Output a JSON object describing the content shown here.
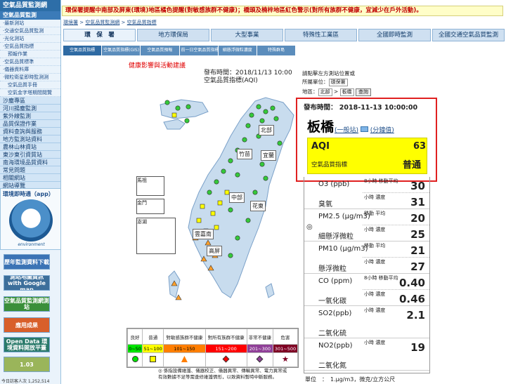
{
  "nav": {
    "header": "空氣品質監測網",
    "items": [
      {
        "label": "空氣品質監測",
        "type": "head"
      },
      {
        "label": "‧最新測站",
        "type": "sub"
      },
      {
        "label": "‧交通空氣品質監測",
        "type": "sub"
      },
      {
        "label": "‧光化測站",
        "type": "sub"
      },
      {
        "label": "‧空氣品質指標",
        "type": "sub"
      },
      {
        "label": "　預報作業",
        "type": "sub"
      },
      {
        "label": "‧空氣品質標準",
        "type": "sub"
      },
      {
        "label": "‧儀器資料庫",
        "type": "sub"
      },
      {
        "label": "‧微粒衛星即時監測測",
        "type": "sub"
      },
      {
        "label": "　空氣品質手冊",
        "type": "sub"
      },
      {
        "label": "　空氣金字塔期間閱覽",
        "type": "sub"
      },
      {
        "label": "沙塵專區",
        "type": "item"
      },
      {
        "label": "河川揚塵監測",
        "type": "item"
      },
      {
        "label": "紫外線監測",
        "type": "item"
      },
      {
        "label": "品質保證作業",
        "type": "item"
      },
      {
        "label": "資料查詢與服務",
        "type": "item"
      },
      {
        "label": "地方監測站資料",
        "type": "item"
      },
      {
        "label": "農林山林資站",
        "type": "item"
      },
      {
        "label": "東沙東引資質站",
        "type": "item"
      },
      {
        "label": "南海環境品質資料",
        "type": "item"
      },
      {
        "label": "常見問題",
        "type": "item"
      },
      {
        "label": "相關網站",
        "type": "item"
      },
      {
        "label": "網站導覽",
        "type": "item"
      }
    ],
    "app_title": "環境即時通（app）",
    "app_caption": "environment",
    "banners": [
      {
        "label": "歷年監測資料下載",
        "color": "#3b73b5"
      },
      {
        "label": "測站地圖資訊 with Google map",
        "color": "#3d6f9b"
      },
      {
        "label": "空氣品質監測網測站",
        "color": "#3a8f3a"
      },
      {
        "label": "應用成果",
        "color": "#d85f2a"
      },
      {
        "label": "Open Data 環境資料開放平臺",
        "color": "#2a7a6a"
      },
      {
        "label": "1.03",
        "color": "#9ab55a"
      }
    ],
    "visitor": "今日訪客人次 1,252,514"
  },
  "alert": "環保署提醒中南部及屏東(環境)地區橘色提醒(對敏感族群不健康)；橋頭及楠梓地區紅色警示(對所有族群不健康，宜減少在戶外活動)。",
  "breadcrumb": [
    "環境署",
    "空氣品質監測網",
    "空氣品質指標"
  ],
  "tabs": [
    "環　保　署",
    "地方環保局",
    "大型事業",
    "特殊性工業區",
    "全國即時監測",
    "全國交通空氣品質監測"
  ],
  "subtabs": [
    "空氣品質指標",
    "空氣品質指標(GIS)",
    "空氣品質預報",
    "前一日空氣品質指標",
    "細懸浮微粒濃度",
    "特殊群島"
  ],
  "map": {
    "health_link": "健康影響與活動建議",
    "time_label": "發布時間：2018/11/13 10:00",
    "aqi_label": "空氣品質指標(AQI)",
    "regions": [
      "北部",
      "竹苗",
      "宜蘭",
      "中部",
      "花東",
      "雲嘉南",
      "高屏",
      "馬祖",
      "金門",
      "澎湖"
    ]
  },
  "controls": {
    "hint": "請點擊左方測站位置或",
    "unit_label": "所屬單位：",
    "unit_value": "環保署",
    "area_label": "地區：",
    "area_value": "北部",
    "station_value": "板橋",
    "query_button": "查詢"
  },
  "station": {
    "publish": "發布時間： 2018-11-13 10:00:00",
    "name": "板橋",
    "link_general": "(一般站)",
    "link_minute": "(分鐘值)",
    "aqi_label": "AQI",
    "aqi_value": "63",
    "aqi_sub": "空氣品質指標",
    "aqi_status": "普通",
    "aqi_color": "#ffff00"
  },
  "pollutants": [
    {
      "name": "O3 (ppb)",
      "cname": "臭氧",
      "l1": "8小時 移動平均",
      "v1": "30",
      "l2": "小時 濃度",
      "v2": "31"
    },
    {
      "name": "PM2.5 (μg/m3)",
      "cname": "細懸浮微粒",
      "l1": "移動 平均",
      "v1": "20",
      "l2": "小時 濃度",
      "v2": "25"
    },
    {
      "name": "PM10 (μg/m3)",
      "cname": "懸浮微粒",
      "l1": "移動 平均",
      "v1": "21",
      "l2": "小時 濃度",
      "v2": "27"
    },
    {
      "name": "CO (ppm)",
      "cname": "一氧化碳",
      "l1": "8小時 移動平均",
      "v1": "0.40",
      "l2": "小時 濃度",
      "v2": "0.46"
    },
    {
      "name": "SO2(ppb)",
      "cname": "二氧化硫",
      "l1": "小時 濃度",
      "v1": "2.1",
      "l2": "",
      "v2": ""
    },
    {
      "name": "NO2(ppb)",
      "cname": "二氧化氮",
      "l1": "小時 濃度",
      "v1": "19",
      "l2": "",
      "v2": ""
    }
  ],
  "units": "單位　：　1.μg/m3，微克/立方公尺",
  "legend": {
    "levels": [
      {
        "label": "良好",
        "range": "0~50",
        "color": "#00e400"
      },
      {
        "label": "普通",
        "range": "51~100",
        "color": "#ffff00"
      },
      {
        "label": "對敏感族群不健康",
        "range": "101~150",
        "color": "#ff7e00"
      },
      {
        "label": "對所有族群不健康",
        "range": "151~200",
        "color": "#ff0000"
      },
      {
        "label": "非常不健康",
        "range": "201~300",
        "color": "#8f3f97"
      },
      {
        "label": "危害",
        "range": "301~500",
        "color": "#7e0023"
      }
    ],
    "note1": "◎ 係指設備維護、儀器校正、儀器異常、傳輸異常、電力異常或",
    "note2": "有效數據不足等需查修維護情形，以致資料暫時中斷服務。"
  }
}
